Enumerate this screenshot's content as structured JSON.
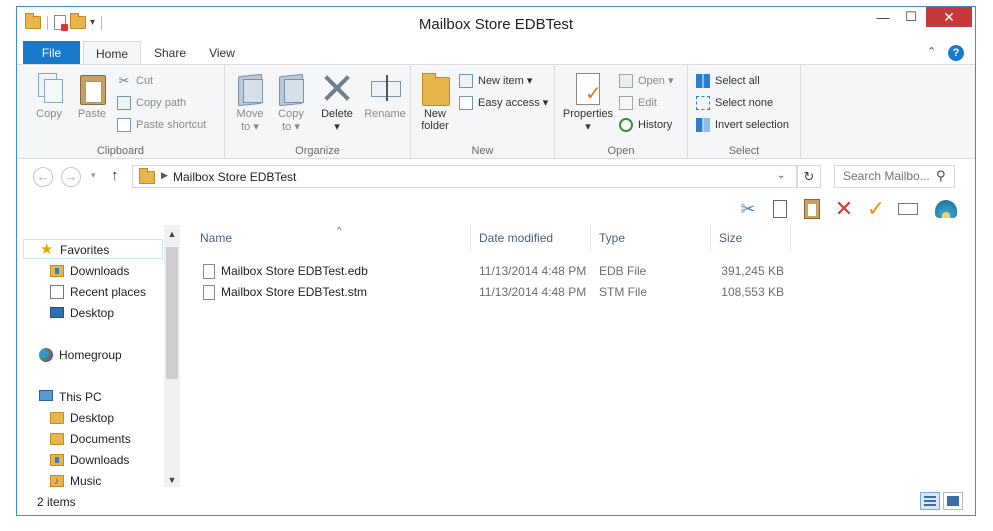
{
  "window": {
    "title": "Mailbox Store EDBTest"
  },
  "tabs": [
    {
      "label": "File"
    },
    {
      "label": "Home"
    },
    {
      "label": "Share"
    },
    {
      "label": "View"
    }
  ],
  "ribbon": {
    "clipboard": {
      "label": "Clipboard",
      "copy": "Copy",
      "paste": "Paste",
      "cut": "Cut",
      "copy_path": "Copy path",
      "paste_shortcut": "Paste shortcut"
    },
    "organize": {
      "label": "Organize",
      "move_to_1": "Move",
      "move_to_2": "to",
      "copy_to_1": "Copy",
      "copy_to_2": "to",
      "delete": "Delete",
      "rename": "Rename"
    },
    "new": {
      "label": "New",
      "new_folder_1": "New",
      "new_folder_2": "folder",
      "new_item": "New item",
      "easy_access": "Easy access"
    },
    "open": {
      "label": "Open",
      "properties": "Properties",
      "open": "Open",
      "edit": "Edit",
      "history": "History"
    },
    "select": {
      "label": "Select",
      "select_all": "Select all",
      "select_none": "Select none",
      "invert_selection": "Invert selection"
    }
  },
  "address": {
    "path": "Mailbox Store EDBTest",
    "search_placeholder": "Search Mailbo..."
  },
  "nav": {
    "favorites": "Favorites",
    "downloads": "Downloads",
    "recent_places": "Recent places",
    "desktop": "Desktop",
    "homegroup": "Homegroup",
    "this_pc": "This PC",
    "pc_desktop": "Desktop",
    "documents": "Documents",
    "pc_downloads": "Downloads",
    "music": "Music"
  },
  "columns": {
    "name": "Name",
    "date": "Date modified",
    "type": "Type",
    "size": "Size"
  },
  "files": [
    {
      "name": "Mailbox Store EDBTest.edb",
      "date": "11/13/2014 4:48 PM",
      "type": "EDB File",
      "size": "391,245 KB"
    },
    {
      "name": "Mailbox Store EDBTest.stm",
      "date": "11/13/2014 4:48 PM",
      "type": "STM File",
      "size": "108,553 KB"
    }
  ],
  "status": {
    "count": "2 items"
  },
  "colors": {
    "accent": "#1979ca",
    "close": "#c7383a",
    "ribbon_bg": "#f5f6f7"
  }
}
